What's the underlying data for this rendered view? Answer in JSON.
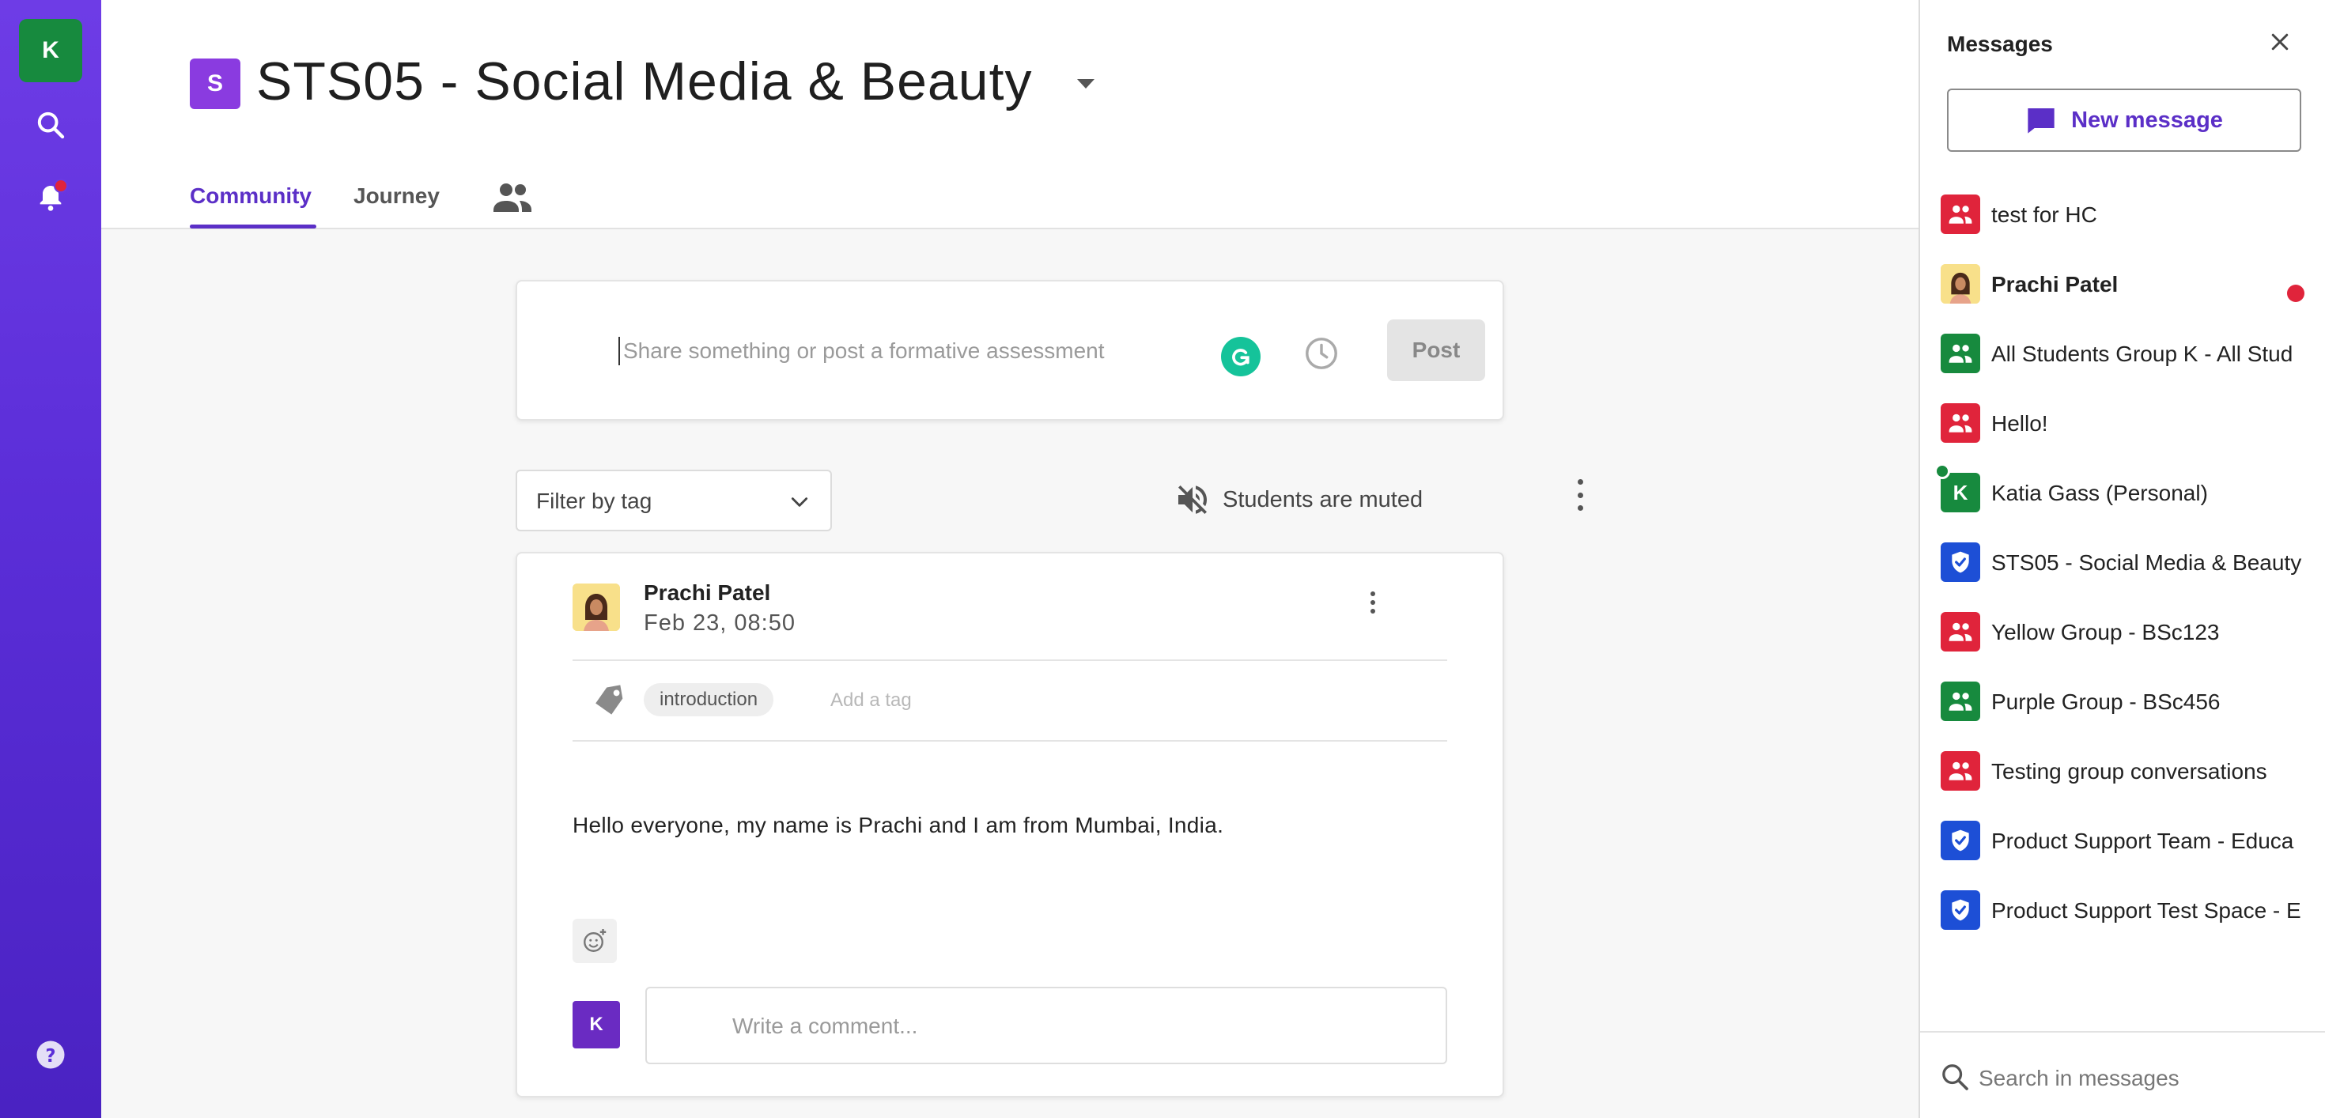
{
  "rail": {
    "avatar_initial": "K",
    "icons": [
      "search-icon",
      "bell-icon",
      "help-icon"
    ],
    "notification_color": "#e0243b",
    "gradient": [
      "#6e3ce6",
      "#4a22c2"
    ]
  },
  "space": {
    "badge": "S",
    "badge_color": "#8a3be0",
    "title": "STS05 - Social Media & Beauty"
  },
  "tabs": [
    {
      "label": "Community",
      "active": true
    },
    {
      "label": "Journey",
      "active": false
    }
  ],
  "composer": {
    "placeholder": "Share something or post a formative assessment",
    "post_label": "Post"
  },
  "filter": {
    "label": "Filter by tag",
    "muted_label": "Students are muted"
  },
  "post": {
    "author": "Prachi Patel",
    "date": "Feb 23, 08:50",
    "tag": "introduction",
    "add_tag": "Add a tag",
    "body": "Hello everyone, my name is Prachi and I am from Mumbai, India.",
    "comment_avatar": "K",
    "comment_placeholder": "Write a comment..."
  },
  "messages": {
    "title": "Messages",
    "new_message_label": "New message",
    "search_placeholder": "Search in messages",
    "accent": "#5b2fc7",
    "conversations": [
      {
        "label": "test for HC",
        "type": "group",
        "color": "#e0243b",
        "bold": false
      },
      {
        "label": "Prachi Patel",
        "type": "person",
        "color": "#f8e08a",
        "bold": true,
        "unread": true
      },
      {
        "label": "All Students Group K - All Stud",
        "type": "group",
        "color": "#178a3e",
        "bold": false
      },
      {
        "label": "Hello!",
        "type": "group",
        "color": "#e0243b",
        "bold": false
      },
      {
        "label": "Katia Gass (Personal)",
        "type": "initial",
        "initial": "K",
        "color": "#178a3e",
        "bold": false,
        "online": true
      },
      {
        "label": "STS05 - Social Media & Beauty",
        "type": "shield",
        "color": "#1d4fd6",
        "bold": false
      },
      {
        "label": "Yellow Group - BSc123",
        "type": "group",
        "color": "#e0243b",
        "bold": false
      },
      {
        "label": "Purple Group - BSc456",
        "type": "group",
        "color": "#178a3e",
        "bold": false
      },
      {
        "label": "Testing group conversations",
        "type": "group",
        "color": "#e0243b",
        "bold": false
      },
      {
        "label": "Product Support Team - Educa",
        "type": "shield",
        "color": "#1d4fd6",
        "bold": false
      },
      {
        "label": "Product Support Test Space - E",
        "type": "shield",
        "color": "#1d4fd6",
        "bold": false
      }
    ]
  }
}
